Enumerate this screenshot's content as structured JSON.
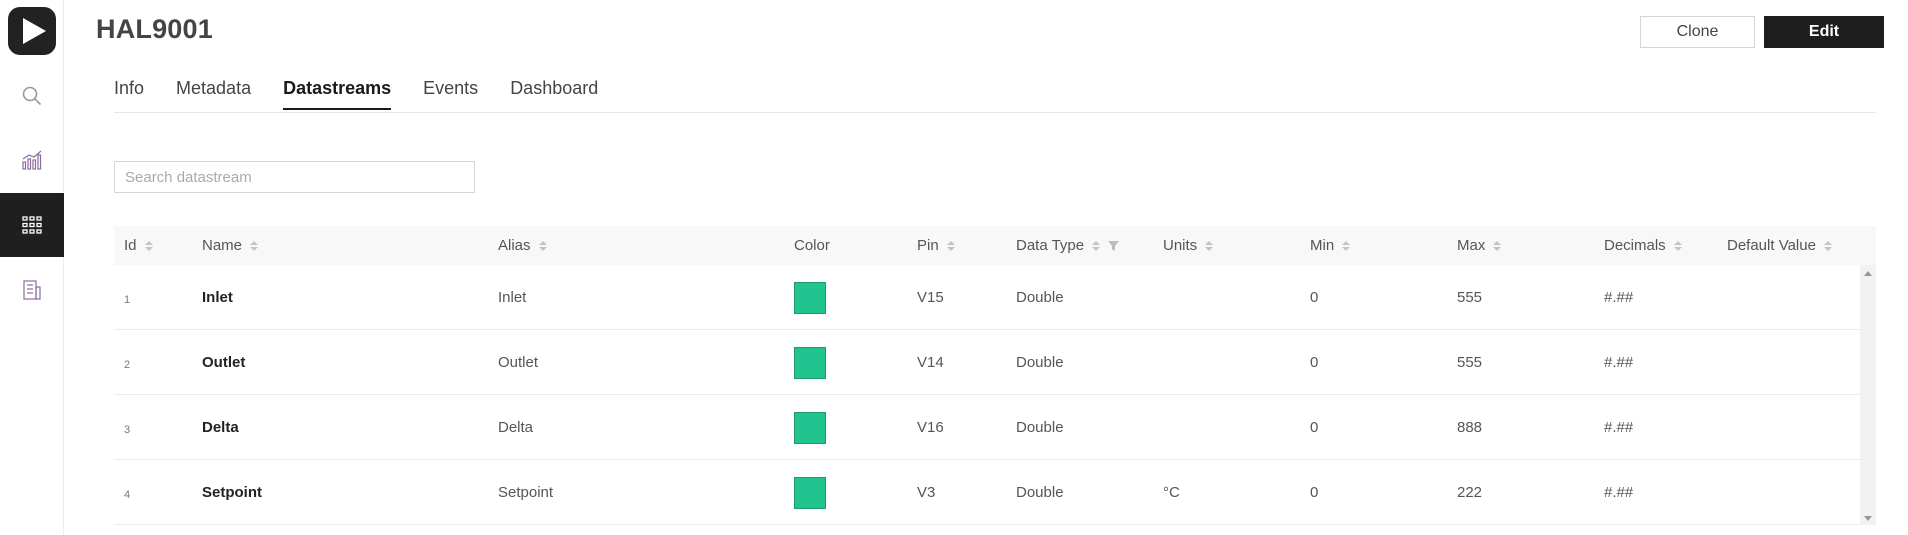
{
  "device": {
    "title": "HAL9001"
  },
  "header": {
    "clone_label": "Clone",
    "edit_label": "Edit"
  },
  "sidebar": {
    "items": [
      {
        "icon": "search-icon"
      },
      {
        "icon": "analytics-icon"
      },
      {
        "icon": "grid-icon",
        "active": true
      },
      {
        "icon": "building-icon"
      }
    ]
  },
  "tabs": [
    {
      "label": "Info"
    },
    {
      "label": "Metadata"
    },
    {
      "label": "Datastreams",
      "active": true
    },
    {
      "label": "Events"
    },
    {
      "label": "Dashboard"
    }
  ],
  "search": {
    "placeholder": "Search datastream",
    "value": ""
  },
  "table": {
    "columns": [
      "Id",
      "Name",
      "Alias",
      "Color",
      "Pin",
      "Data Type",
      "Units",
      "Min",
      "Max",
      "Decimals",
      "Default Value"
    ],
    "rows": [
      {
        "id": "1",
        "name": "Inlet",
        "alias": "Inlet",
        "color": "#21c38e",
        "pin": "V15",
        "data_type": "Double",
        "units": "",
        "min": "0",
        "max": "555",
        "decimals": "#.##",
        "default_value": ""
      },
      {
        "id": "2",
        "name": "Outlet",
        "alias": "Outlet",
        "color": "#21c38e",
        "pin": "V14",
        "data_type": "Double",
        "units": "",
        "min": "0",
        "max": "555",
        "decimals": "#.##",
        "default_value": ""
      },
      {
        "id": "3",
        "name": "Delta",
        "alias": "Delta",
        "color": "#21c38e",
        "pin": "V16",
        "data_type": "Double",
        "units": "",
        "min": "0",
        "max": "888",
        "decimals": "#.##",
        "default_value": ""
      },
      {
        "id": "4",
        "name": "Setpoint",
        "alias": "Setpoint",
        "color": "#21c38e",
        "pin": "V3",
        "data_type": "Double",
        "units": "°C",
        "min": "0",
        "max": "222",
        "decimals": "#.##",
        "default_value": ""
      }
    ]
  },
  "colors": {
    "accent": "#1e1e1e",
    "swatch": "#21c38e",
    "icon_purple": "#8a6b9e"
  }
}
